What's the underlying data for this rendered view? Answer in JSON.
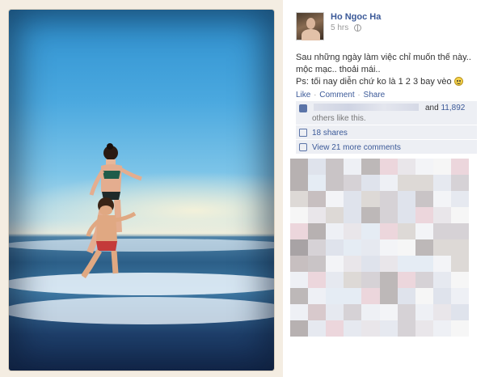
{
  "post": {
    "author": "Ho Ngoc Ha",
    "time": "5 hrs",
    "status_line1": "Sau những ngày làm việc chỉ muốn thế này.. mộc mạc.. thoải mái..",
    "status_line2": "Ps: tối nay diễn chứ ko là 1 2 3 bay vèo"
  },
  "actions": {
    "like": "Like",
    "comment": "Comment",
    "share": "Share",
    "sep": "·"
  },
  "ufi": {
    "likes_prefix": "and",
    "likes_count": "11,892",
    "likes_tail": "others like this.",
    "shares": "18 shares",
    "more_comments": "View 21 more comments"
  },
  "icons": [
    "globe-icon",
    "smiley-icon",
    "like-icon",
    "share-icon",
    "comment-icon"
  ],
  "colors": {
    "brand_link": "#3b5998",
    "ufi_bg": "#edeff4",
    "photo_frame": "#f4ede2"
  }
}
